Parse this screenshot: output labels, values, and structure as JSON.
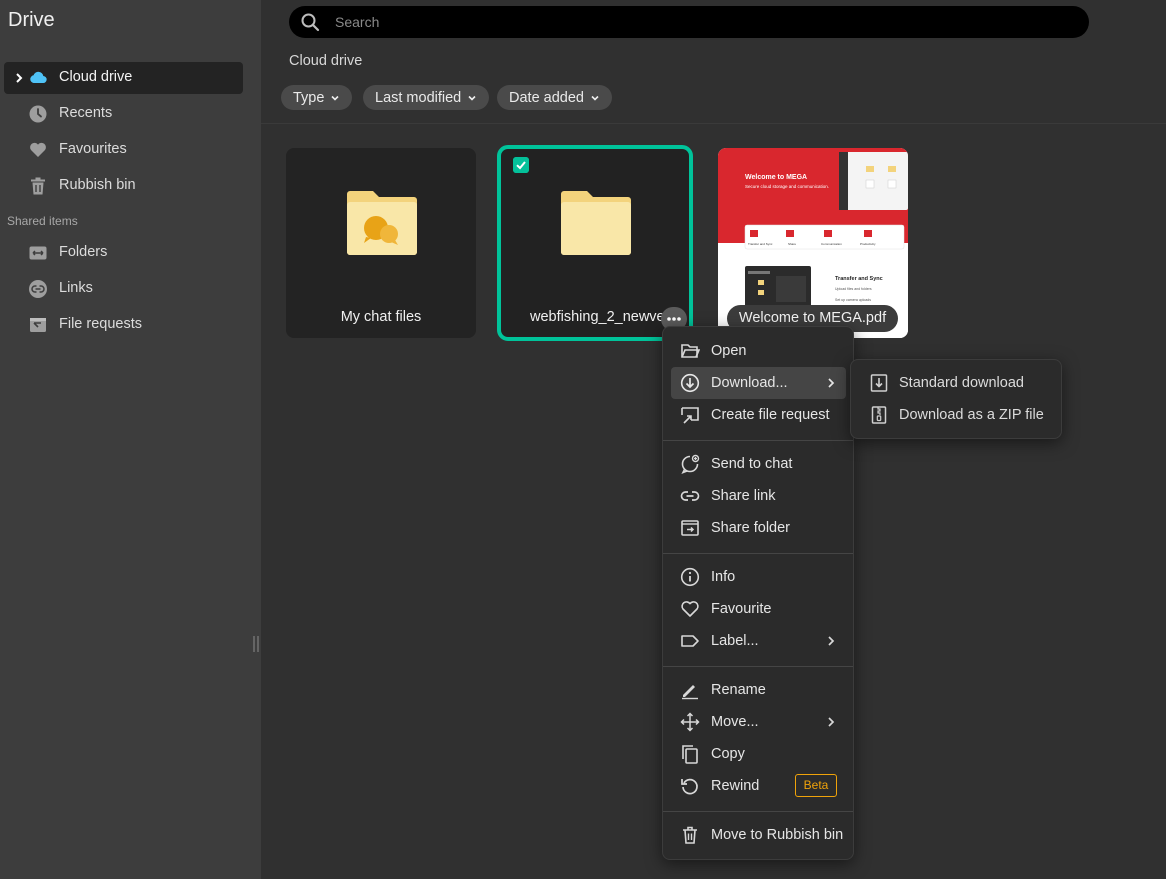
{
  "sidebar": {
    "title": "Drive",
    "items": [
      {
        "label": "Cloud drive",
        "icon": "cloud-icon",
        "active": true
      },
      {
        "label": "Recents",
        "icon": "clock-icon"
      },
      {
        "label": "Favourites",
        "icon": "heart-icon"
      },
      {
        "label": "Rubbish bin",
        "icon": "trash-icon"
      }
    ],
    "shared_section": "Shared items",
    "shared_items": [
      {
        "label": "Folders",
        "icon": "shared-folder-icon"
      },
      {
        "label": "Links",
        "icon": "link-icon"
      },
      {
        "label": "File requests",
        "icon": "file-request-icon"
      }
    ]
  },
  "search": {
    "placeholder": "Search"
  },
  "breadcrumb": "Cloud drive",
  "filters": [
    "Type",
    "Last modified",
    "Date added"
  ],
  "files": [
    {
      "name": "My chat files",
      "type": "chat-folder"
    },
    {
      "name": "webfishing_2_newver",
      "type": "folder",
      "selected": true
    },
    {
      "name": "Welcome to MEGA.pdf",
      "type": "pdf"
    }
  ],
  "pdf_thumb": {
    "heading": "Welcome to MEGA",
    "sub": "Secure cloud storage and communication.",
    "tiles": [
      "Transfer and Sync",
      "Share",
      "Communication",
      "Productivity"
    ],
    "section": "Transfer and Sync",
    "bullets": [
      "Upload files and folders",
      "Set up camera uploads"
    ]
  },
  "context_menu": {
    "groups": [
      [
        {
          "label": "Open",
          "icon": "folder-open-icon"
        },
        {
          "label": "Download...",
          "icon": "download-circle-icon",
          "submenu": true,
          "highlighted": true
        },
        {
          "label": "Create file request",
          "icon": "file-request-icon"
        }
      ],
      [
        {
          "label": "Send to chat",
          "icon": "send-chat-icon"
        },
        {
          "label": "Share link",
          "icon": "link-icon"
        },
        {
          "label": "Share folder",
          "icon": "share-folder-icon"
        }
      ],
      [
        {
          "label": "Info",
          "icon": "info-icon"
        },
        {
          "label": "Favourite",
          "icon": "heart-outline-icon"
        },
        {
          "label": "Label...",
          "icon": "tag-icon",
          "submenu": true
        }
      ],
      [
        {
          "label": "Rename",
          "icon": "pencil-icon"
        },
        {
          "label": "Move...",
          "icon": "move-icon",
          "submenu": true
        },
        {
          "label": "Copy",
          "icon": "copy-icon"
        },
        {
          "label": "Rewind",
          "icon": "rewind-icon",
          "badge": "Beta"
        }
      ],
      [
        {
          "label": "Move to Rubbish bin",
          "icon": "trash-icon"
        }
      ]
    ]
  },
  "download_submenu": [
    {
      "label": "Standard download",
      "icon": "download-file-icon"
    },
    {
      "label": "Download as a ZIP file",
      "icon": "zip-icon"
    }
  ],
  "colors": {
    "accent": "#00c39a",
    "beta": "#f0a30a",
    "folder": "#f9e7a8",
    "mega_red": "#d9272e"
  }
}
